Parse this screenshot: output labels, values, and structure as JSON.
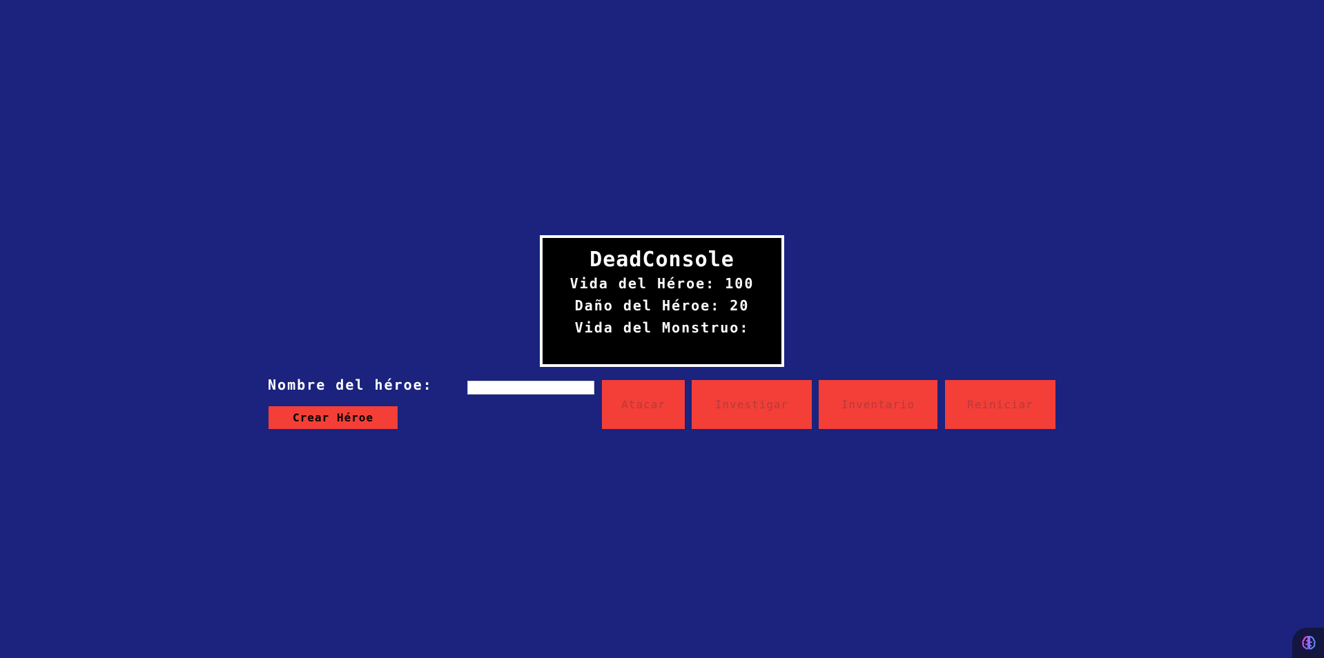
{
  "console": {
    "title": "DeadConsole",
    "hero_life": "Vida del Héroe: 100",
    "hero_damage": "Daño del Héroe: 20",
    "monster_life": "Vida del Monstruo:"
  },
  "hero_form": {
    "name_label": "Nombre del héroe:",
    "name_value": "",
    "create_button": "Crear Héroe"
  },
  "actions": {
    "attack": "Atacar",
    "investigate": "Investigar",
    "inventory": "Inventario",
    "restart": "Reiniciar"
  },
  "colors": {
    "background": "#1b237e",
    "button": "#f33f37",
    "disabled_text": "#b73a3e",
    "console_bg": "#000000",
    "console_border": "#ffffff"
  },
  "icons": {
    "extension_widget": "brain-icon"
  }
}
